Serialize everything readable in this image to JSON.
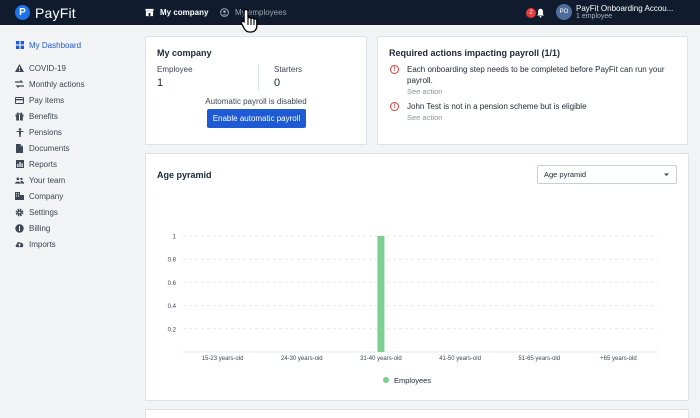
{
  "brand": {
    "name": "PayFit",
    "mark": "P"
  },
  "topnav": {
    "tabs": [
      {
        "label": "My company"
      },
      {
        "label": "My employees"
      }
    ],
    "notification_count": "2",
    "account": {
      "initials": "PO",
      "name": "PayFit Onboarding Accou...",
      "subtitle": "1 employee"
    }
  },
  "sidebar": {
    "items": [
      {
        "label": "My Dashboard",
        "icon": "grid-icon"
      },
      {
        "label": "COVID-19",
        "icon": "warning-icon"
      },
      {
        "label": "Monthly actions",
        "icon": "transfer-icon"
      },
      {
        "label": "Pay items",
        "icon": "card-icon"
      },
      {
        "label": "Benefits",
        "icon": "gift-icon"
      },
      {
        "label": "Pensions",
        "icon": "person-icon"
      },
      {
        "label": "Documents",
        "icon": "document-icon"
      },
      {
        "label": "Reports",
        "icon": "bar-chart-icon"
      },
      {
        "label": "Your team",
        "icon": "team-icon"
      },
      {
        "label": "Company",
        "icon": "building-icon"
      },
      {
        "label": "Settings",
        "icon": "gear-icon"
      },
      {
        "label": "Billing",
        "icon": "coin-icon"
      },
      {
        "label": "Imports",
        "icon": "cloud-upload-icon"
      }
    ]
  },
  "company_card": {
    "title": "My company",
    "employee_label": "Employee",
    "employee_value": "1",
    "starters_label": "Starters",
    "starters_value": "0",
    "payroll_status": "Automatic payroll is disabled",
    "enable_button": "Enable automatic payroll"
  },
  "actions_card": {
    "title": "Required actions impacting payroll (1/1)",
    "items": [
      {
        "text": "Each onboarding step needs to be completed before PayFit can run your payroll.",
        "link": "See action"
      },
      {
        "text": "John Test is not in a pension scheme but is eligible",
        "link": "See action"
      }
    ]
  },
  "pyramid_card": {
    "title": "Age pyramid",
    "select_value": "Age pyramid"
  },
  "chart_data": {
    "type": "bar",
    "categories": [
      "15-23 years-old",
      "24-30 years-old",
      "31-40 years-old",
      "41-50 years-old",
      "51-65 years-old",
      "+65 years-old"
    ],
    "series": [
      {
        "name": "Employees",
        "values": [
          0,
          0,
          1,
          0,
          0,
          0
        ]
      }
    ],
    "yticks": [
      "0.2",
      "0.4",
      "0.6",
      "0.8",
      "1"
    ],
    "ylim": [
      0,
      1
    ],
    "grid": true,
    "legend": "bottom",
    "colors": {
      "bar": "#7ccf8f"
    }
  },
  "colors": {
    "topbar": "#101c2e",
    "accent": "#1e5ad4",
    "warning": "#d23c3c"
  }
}
